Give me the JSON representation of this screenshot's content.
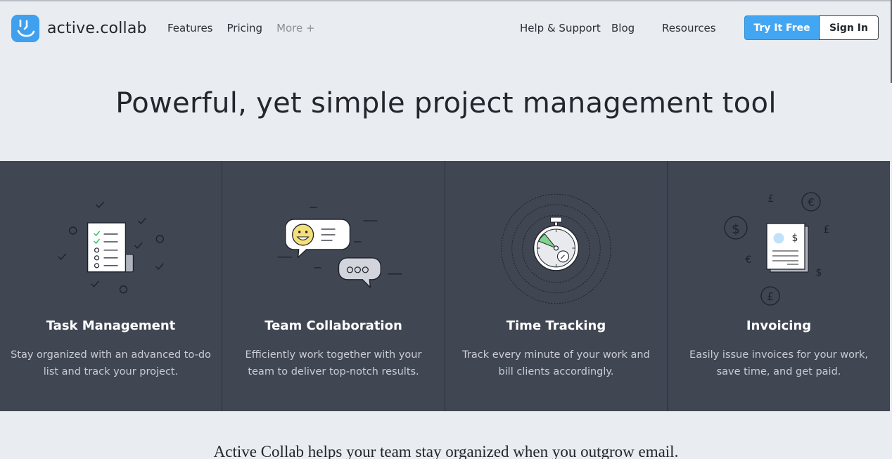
{
  "brand": {
    "name": "active.collab",
    "accent": "#3fa0ef"
  },
  "nav_left": [
    {
      "label": "Features"
    },
    {
      "label": "Pricing"
    },
    {
      "label": "More +"
    }
  ],
  "nav_right": [
    {
      "label": "Help & Support"
    },
    {
      "label": "Blog"
    },
    {
      "label": "Resources"
    }
  ],
  "buttons": {
    "try": "Try It Free",
    "sign_in": "Sign In"
  },
  "hero": {
    "title": "Powerful, yet simple project management tool"
  },
  "features": [
    {
      "title": "Task Management",
      "description": "Stay organized with an advanced to-do list and track your project.",
      "icon": "task-list-icon"
    },
    {
      "title": "Team Collaboration",
      "description": "Efficiently work together with your team to deliver top-notch results.",
      "icon": "chat-bubbles-icon"
    },
    {
      "title": "Time Tracking",
      "description": "Track every minute of your work and bill clients accordingly.",
      "icon": "stopwatch-icon"
    },
    {
      "title": "Invoicing",
      "description": "Easily issue invoices for your work, save time, and get paid.",
      "icon": "invoice-icon"
    }
  ],
  "currency_symbols": {
    "dollar": "$",
    "euro": "€",
    "pound": "£"
  },
  "tagline": "Active Collab helps your team stay organized when you outgrow email.",
  "colors": {
    "feature_bg": "#414653",
    "page_bg": "#e9ecf0",
    "try_button": "#43a6f2"
  }
}
